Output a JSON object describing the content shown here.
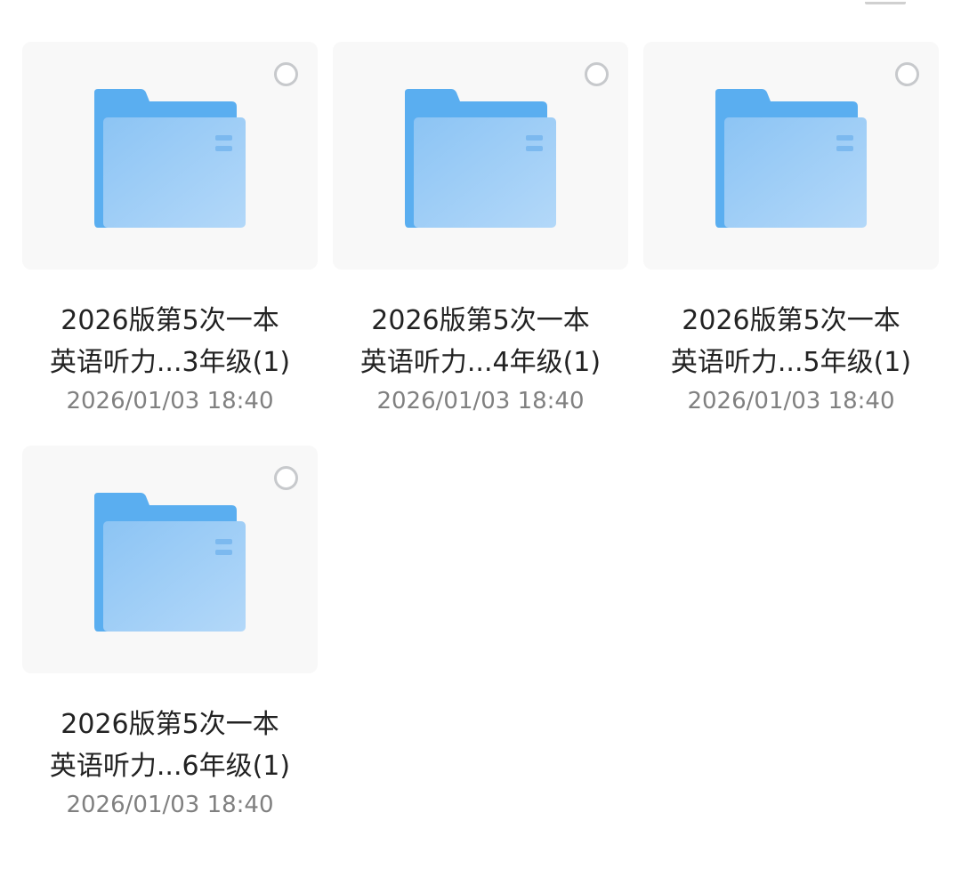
{
  "files": [
    {
      "line1": "2026版第5次一本",
      "line2": "英语听力...3年级(1)",
      "date": "2026/01/03 18:40",
      "icon": "folder-icon"
    },
    {
      "line1": "2026版第5次一本",
      "line2": "英语听力...4年级(1)",
      "date": "2026/01/03 18:40",
      "icon": "folder-icon"
    },
    {
      "line1": "2026版第5次一本",
      "line2": "英语听力...5年级(1)",
      "date": "2026/01/03 18:40",
      "icon": "folder-icon"
    },
    {
      "line1": "2026版第5次一本",
      "line2": "英语听力...6年级(1)",
      "date": "2026/01/03 18:40",
      "icon": "folder-icon"
    }
  ],
  "colors": {
    "folder_back": "#5aaef0",
    "folder_front_start": "#8cc4f4",
    "folder_front_end": "#b3d8f9",
    "tile_bg": "#f8f8f8",
    "date_text": "#808080"
  }
}
